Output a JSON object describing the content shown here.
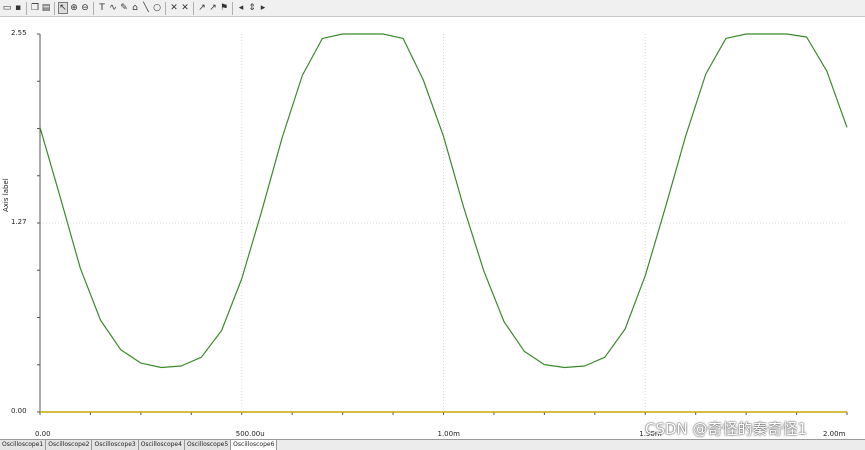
{
  "toolbar": {
    "buttons": [
      {
        "name": "open-icon",
        "glyph": "▭"
      },
      {
        "name": "save-icon",
        "glyph": "▪"
      },
      {
        "name": "copy-icon",
        "glyph": "❐"
      },
      {
        "name": "paste-icon",
        "glyph": "▤"
      },
      {
        "name": "pointer-icon",
        "glyph": "↖"
      },
      {
        "name": "zoom-in-icon",
        "glyph": "⊕"
      },
      {
        "name": "zoom-out-icon",
        "glyph": "⊖"
      },
      {
        "name": "text-tool-icon",
        "glyph": "T"
      },
      {
        "name": "curve-tool-icon",
        "glyph": "∿"
      },
      {
        "name": "marker-tool-icon",
        "glyph": "✎"
      },
      {
        "name": "shape-tool-icon",
        "glyph": "⌂"
      },
      {
        "name": "line-tool-icon",
        "glyph": "╲"
      },
      {
        "name": "ellipse-tool-icon",
        "glyph": "○"
      },
      {
        "name": "cursor-a-icon",
        "glyph": "✕"
      },
      {
        "name": "cursor-b-icon",
        "glyph": "✕"
      },
      {
        "name": "trace-a-icon",
        "glyph": "↗"
      },
      {
        "name": "trace-b-icon",
        "glyph": "↗"
      },
      {
        "name": "flag-icon",
        "glyph": "⚑"
      },
      {
        "name": "left-arrow-icon",
        "glyph": "◂"
      },
      {
        "name": "updown-arrow-icon",
        "glyph": "⇕"
      },
      {
        "name": "right-arrow-icon",
        "glyph": "▸"
      }
    ]
  },
  "axis": {
    "y_label": "Axis label"
  },
  "tabs": [
    "Oscilloscope1",
    "Oscilloscope2",
    "Oscilloscope3",
    "Oscilloscope4",
    "Oscilloscope5",
    "Oscilloscope6"
  ],
  "active_tab": 5,
  "watermark": "CSDN @奇怪的秦奇怪1",
  "colors": {
    "trace": "#3a8a2a",
    "baseline": "#c8a800",
    "grid": "#d8d8d8"
  },
  "chart_data": {
    "type": "line",
    "ylim": [
      0,
      2.55
    ],
    "xlim": [
      0,
      0.002
    ],
    "y_ticks": [
      {
        "v": 2.55,
        "label": "2.55"
      },
      {
        "v": 1.275,
        "label": "1.27"
      },
      {
        "v": 0,
        "label": "0.00"
      }
    ],
    "x_ticks": [
      {
        "v": 0,
        "label": "0.00"
      },
      {
        "v": 0.0005,
        "label": "500.00u"
      },
      {
        "v": 0.001,
        "label": "1.00m"
      },
      {
        "v": 0.0015,
        "label": "1.50m"
      },
      {
        "v": 0.002,
        "label": "2.00m"
      }
    ],
    "series": [
      {
        "x": [
          0,
          5e-05,
          0.0001,
          0.00015,
          0.0002,
          0.00025,
          0.0003,
          0.00035,
          0.0004,
          0.00045,
          0.0005,
          0.00055,
          0.0006,
          0.00065,
          0.0007,
          0.00075,
          0.0008,
          0.00085,
          0.0009,
          0.00095,
          0.001,
          0.00105,
          0.0011,
          0.00115,
          0.0012,
          0.00125,
          0.0013,
          0.00135,
          0.0014,
          0.00145,
          0.0015,
          0.00155,
          0.0016,
          0.00165,
          0.0017,
          0.00175,
          0.0018,
          0.00185,
          0.0019,
          0.00195,
          0.002
        ],
        "values": [
          1.92,
          1.45,
          0.97,
          0.62,
          0.42,
          0.33,
          0.3,
          0.31,
          0.37,
          0.55,
          0.9,
          1.36,
          1.85,
          2.27,
          2.52,
          2.55,
          2.55,
          2.55,
          2.52,
          2.24,
          1.86,
          1.38,
          0.95,
          0.61,
          0.41,
          0.32,
          0.3,
          0.31,
          0.37,
          0.56,
          0.92,
          1.38,
          1.86,
          2.28,
          2.52,
          2.55,
          2.55,
          2.55,
          2.53,
          2.3,
          1.92
        ]
      },
      {
        "x": [
          0,
          0.002
        ],
        "values": [
          0,
          0
        ]
      }
    ]
  }
}
